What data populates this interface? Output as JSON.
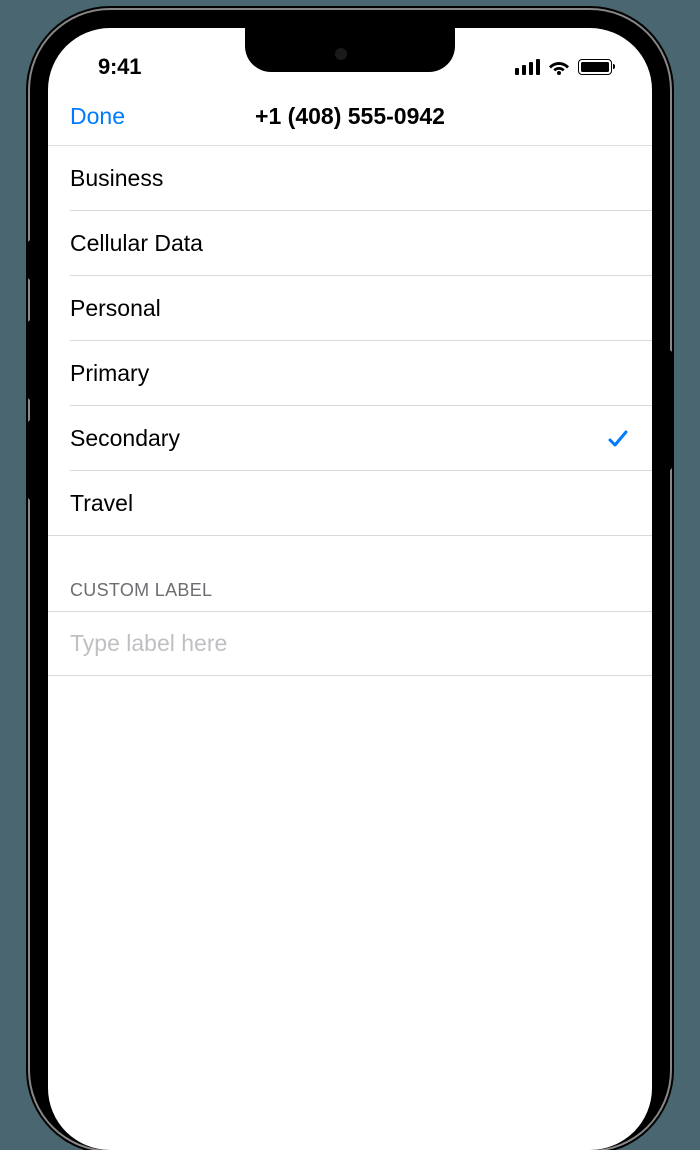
{
  "status": {
    "time": "9:41"
  },
  "nav": {
    "done_label": "Done",
    "title": "+1 (408) 555-0942"
  },
  "labels": [
    {
      "text": "Business",
      "selected": false
    },
    {
      "text": "Cellular Data",
      "selected": false
    },
    {
      "text": "Personal",
      "selected": false
    },
    {
      "text": "Primary",
      "selected": false
    },
    {
      "text": "Secondary",
      "selected": true
    },
    {
      "text": "Travel",
      "selected": false
    }
  ],
  "custom": {
    "header": "CUSTOM LABEL",
    "placeholder": "Type label here",
    "value": ""
  }
}
